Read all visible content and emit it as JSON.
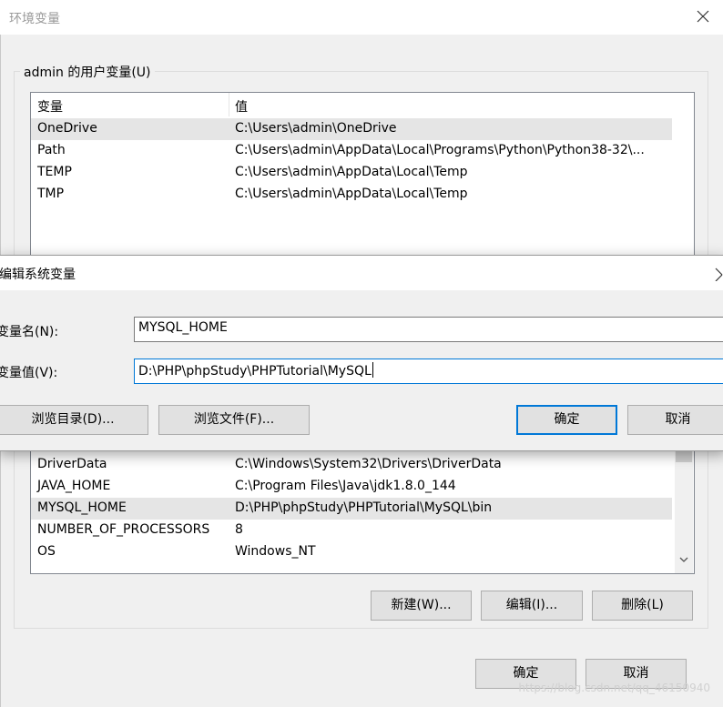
{
  "outer_window": {
    "title": "环境变量",
    "user_group_label": "admin 的用户变量(U)",
    "user_table": {
      "headers": [
        "变量",
        "值"
      ],
      "rows": [
        {
          "name": "OneDrive",
          "value": "C:\\Users\\admin\\OneDrive"
        },
        {
          "name": "Path",
          "value": "C:\\Users\\admin\\AppData\\Local\\Programs\\Python\\Python38-32\\..."
        },
        {
          "name": "TEMP",
          "value": "C:\\Users\\admin\\AppData\\Local\\Temp"
        },
        {
          "name": "TMP",
          "value": "C:\\Users\\admin\\AppData\\Local\\Temp"
        }
      ]
    },
    "system_table": {
      "rows": [
        {
          "name": "DriverData",
          "value": "C:\\Windows\\System32\\Drivers\\DriverData"
        },
        {
          "name": "JAVA_HOME",
          "value": "C:\\Program Files\\Java\\jdk1.8.0_144"
        },
        {
          "name": "MYSQL_HOME",
          "value": "D:\\PHP\\phpStudy\\PHPTutorial\\MySQL\\bin"
        },
        {
          "name": "NUMBER_OF_PROCESSORS",
          "value": "8"
        },
        {
          "name": "OS",
          "value": "Windows_NT"
        }
      ]
    },
    "system_buttons": {
      "new": "新建(W)...",
      "edit": "编辑(I)...",
      "delete": "删除(L)"
    },
    "footer_buttons": {
      "ok": "确定",
      "cancel": "取消"
    }
  },
  "modal": {
    "title": "编辑系统变量",
    "name_label": "变量名(N):",
    "value_label": "变量值(V):",
    "name_value": "MYSQL_HOME",
    "value_value": "D:\\PHP\\phpStudy\\PHPTutorial\\MySQL",
    "browse_dir": "浏览目录(D)...",
    "browse_file": "浏览文件(F)...",
    "ok": "确定",
    "cancel": "取消"
  },
  "watermark": "https://blog.csdn.net/qq_46150940",
  "colors": {
    "accent": "#0078d7",
    "selected_row": "#e5e5e5",
    "background": "#f0f0f0"
  }
}
